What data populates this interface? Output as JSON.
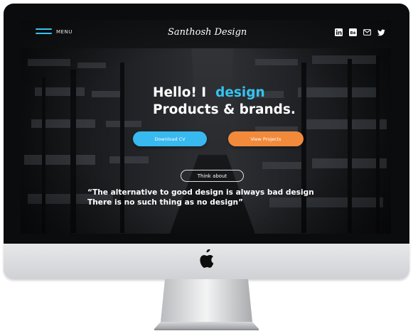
{
  "header": {
    "menu_label": "MENU",
    "brand": "Santhosh Design"
  },
  "socials": [
    {
      "icon": "linkedin-icon"
    },
    {
      "icon": "behance-icon",
      "text": "Bē"
    },
    {
      "icon": "mail-icon"
    },
    {
      "icon": "twitter-icon"
    }
  ],
  "hero": {
    "line1_prefix": "Hello! I",
    "line1_accent": "design",
    "line2": "Products & brands.",
    "accent_color": "#35c4f0"
  },
  "buttons": {
    "download_cv": "Download CV",
    "view_projects": "View Projects",
    "download_color": "#38b9ef",
    "projects_color": "#f28a3c"
  },
  "think_about": "Think about",
  "quote": {
    "line1": "“The alternative to good design is always bad design",
    "line2": "There is no such thing as no design”"
  }
}
